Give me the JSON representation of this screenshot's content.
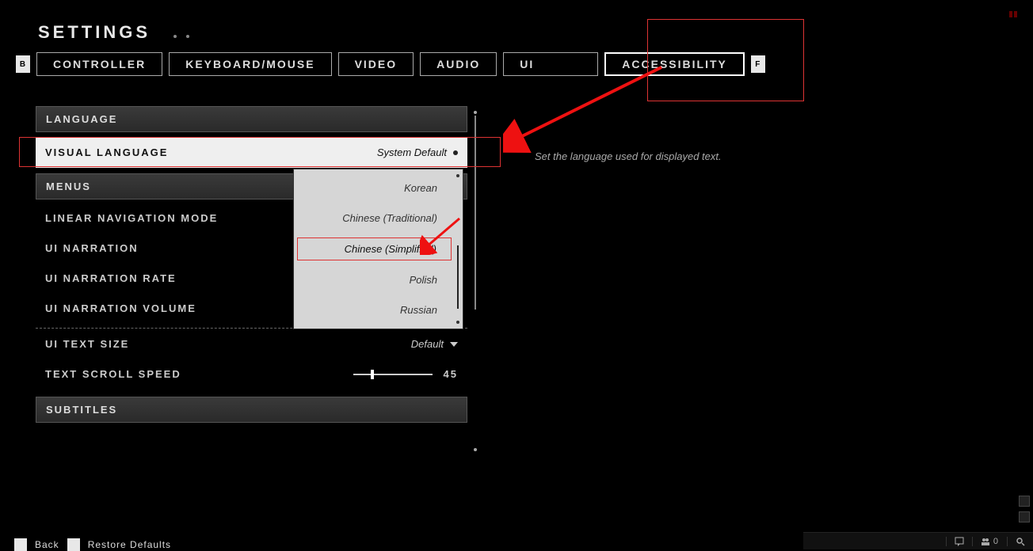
{
  "header": {
    "title": "SETTINGS",
    "bumper_left": "B",
    "bumper_right": "F"
  },
  "tabs": [
    {
      "label": "CONTROLLER"
    },
    {
      "label": "KEYBOARD/MOUSE"
    },
    {
      "label": "VIDEO"
    },
    {
      "label": "AUDIO"
    },
    {
      "label": "UI"
    },
    {
      "label": "ACCESSIBILITY"
    }
  ],
  "sections": {
    "language_header": "LANGUAGE",
    "menus_header": "MENUS",
    "subtitles_header": "SUBTITLES"
  },
  "rows": {
    "visual_language": {
      "label": "VISUAL LANGUAGE",
      "value": "System Default"
    },
    "linear_nav": {
      "label": "LINEAR NAVIGATION MODE"
    },
    "ui_narration": {
      "label": "UI NARRATION"
    },
    "ui_narration_rate": {
      "label": "UI NARRATION RATE"
    },
    "ui_narration_volume": {
      "label": "UI NARRATION VOLUME"
    },
    "ui_text_size": {
      "label": "UI TEXT SIZE",
      "value": "Default"
    },
    "text_scroll_speed": {
      "label": "TEXT SCROLL SPEED",
      "value": "45"
    }
  },
  "dropdown": {
    "items": [
      {
        "label": "Korean"
      },
      {
        "label": "Chinese (Traditional)"
      },
      {
        "label": "Chinese (Simplified)"
      },
      {
        "label": "Polish"
      },
      {
        "label": "Russian"
      }
    ]
  },
  "help": {
    "text": "Set the language used for displayed text."
  },
  "footer": {
    "back_label": "Back",
    "restore_label": "Restore Defaults"
  },
  "statusbar": {
    "count": "0"
  }
}
